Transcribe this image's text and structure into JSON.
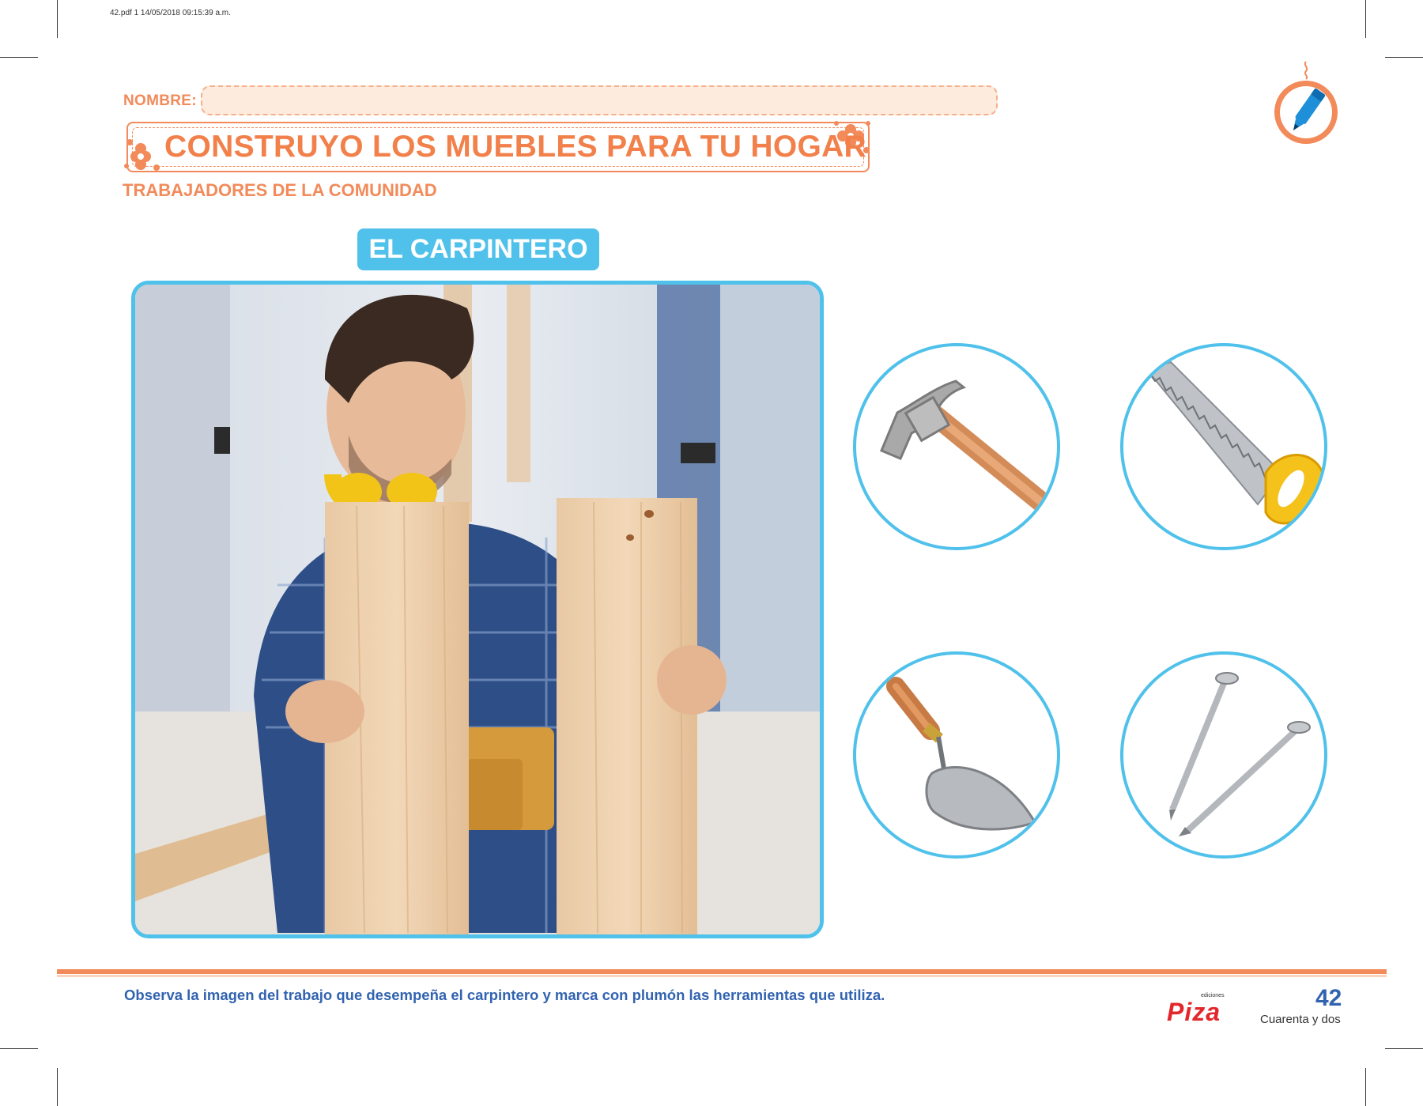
{
  "file_info": "42.pdf   1   14/05/2018   09:15:39 a.m.",
  "header": {
    "nombre_label": "NOMBRE:",
    "title": "CONSTRUYO LOS MUEBLES PARA TU HOGAR",
    "subtitle": "TRABAJADORES DE LA COMUNIDAD",
    "activity_icon": "marker-pen-icon"
  },
  "section": {
    "badge": "EL CARPINTERO",
    "photo": "carpenter-holding-wooden-boards-photo"
  },
  "tools": [
    {
      "icon": "hammer-icon"
    },
    {
      "icon": "saw-icon"
    },
    {
      "icon": "trowel-icon"
    },
    {
      "icon": "nails-icon"
    }
  ],
  "footer": {
    "instruction": "Observa la imagen del trabajo que desempeña el carpintero y marca con plumón las herramientas que utiliza.",
    "brand_small": "ediciones",
    "brand": "Piza",
    "page_number": "42",
    "page_words": "Cuarenta y dos"
  },
  "colors": {
    "orange": "#F28A5A",
    "blue": "#4FC1EA",
    "dark_blue": "#3263B0",
    "brand_red": "#E3262B"
  }
}
